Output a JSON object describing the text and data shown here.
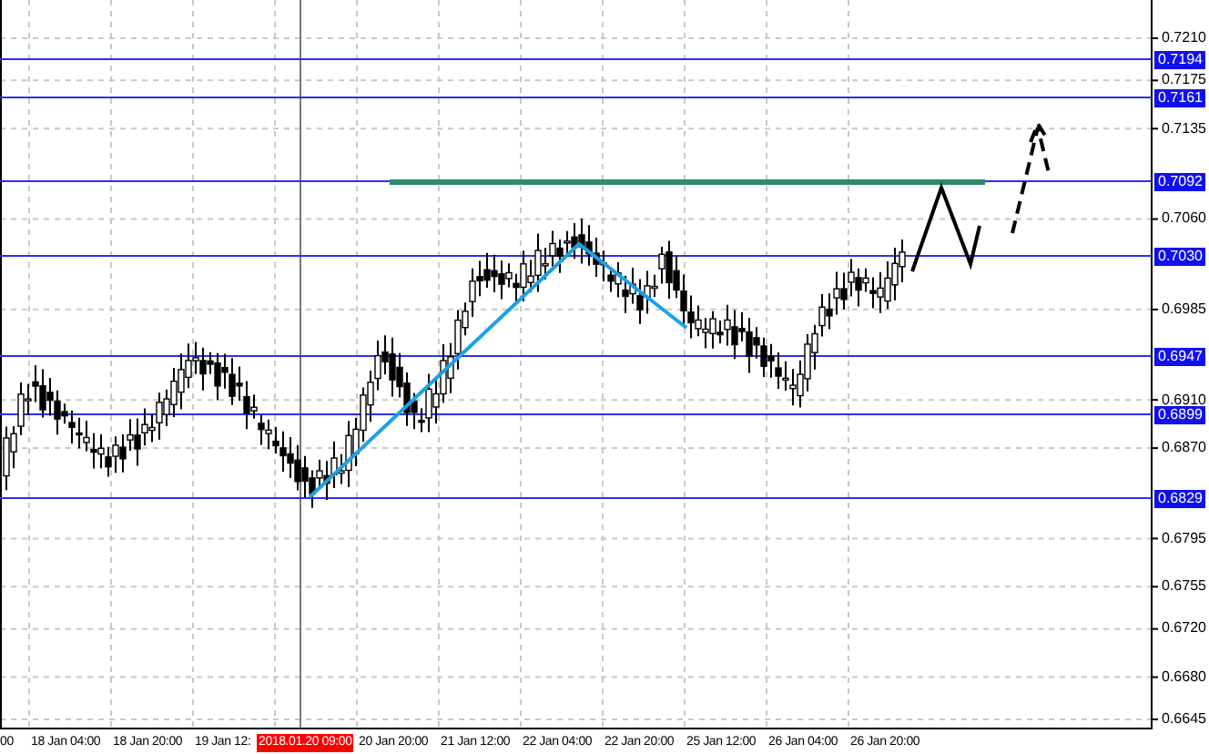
{
  "price_axis": {
    "ticks": [
      "0.7210",
      "0.7175",
      "0.7135",
      "0.7060",
      "0.6985",
      "0.6910",
      "0.6870",
      "0.6795",
      "0.6755",
      "0.6720",
      "0.6680",
      "0.6645"
    ]
  },
  "levels": [
    {
      "label": "0.7194"
    },
    {
      "label": "0.7161"
    },
    {
      "label": "0.7092"
    },
    {
      "label": "0.7030"
    },
    {
      "label": "0.6947"
    },
    {
      "label": "0.6899"
    },
    {
      "label": "0.6829"
    }
  ],
  "time_axis": {
    "labels": [
      "00",
      "18 Jan 04:00",
      "18 Jan 20:00",
      "19 Jan 12:",
      "20 Jan 20:00",
      "21 Jan 12:00",
      "22 Jan 04:00",
      "22 Jan 20:00",
      "25 Jan 12:00",
      "26 Jan 04:00",
      "26 Jan 20:00"
    ],
    "marker": "2018.01.20 09:00"
  }
}
